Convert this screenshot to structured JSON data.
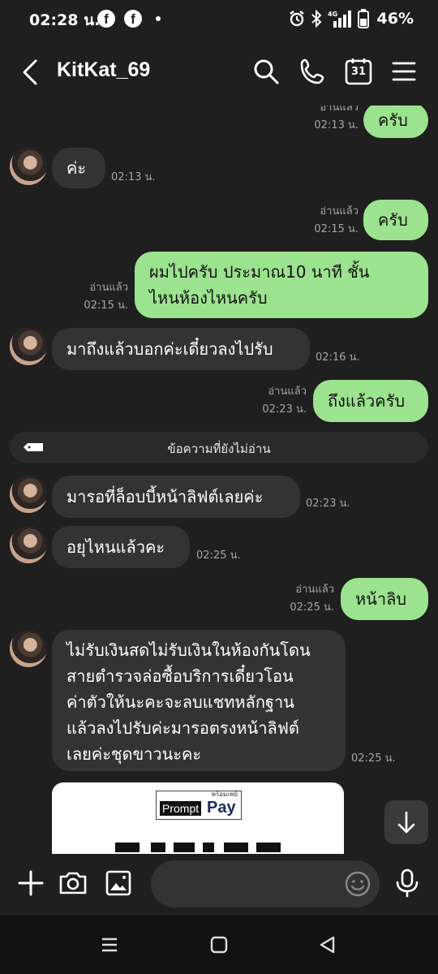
{
  "status_bar": {
    "time": "02:28 น.",
    "battery_percent": "46%",
    "network": "4G",
    "icons": [
      "facebook-icon",
      "facebook-icon",
      "notification-dot",
      "alarm-icon",
      "bluetooth-icon",
      "signal-icon",
      "battery-icon"
    ]
  },
  "header": {
    "title": "KitKat_69",
    "calendar_day": "31",
    "icons": [
      "back-icon",
      "search-icon",
      "phone-icon",
      "calendar-icon",
      "menu-icon"
    ]
  },
  "messages": [
    {
      "side": "out",
      "text": "ครับ",
      "read": "อ่านแล้ว",
      "time": "02:13 น."
    },
    {
      "side": "in",
      "text": "ค่ะ",
      "time": "02:13 น."
    },
    {
      "side": "out",
      "text": "ครับ",
      "read": "อ่านแล้ว",
      "time": "02:15 น."
    },
    {
      "side": "out",
      "lines": [
        "ผมไปครับ ประมาณ10 นาที ชั้น",
        "ไหนห้องไหนครับ"
      ],
      "read": "อ่านแล้ว",
      "time": "02:15 น."
    },
    {
      "side": "in",
      "text": "มาถึงแล้วบอกค่ะเดี๋ยวลงไปรับ",
      "time": "02:16 น."
    },
    {
      "side": "out",
      "text": "ถึงแล้วครับ",
      "read": "อ่านแล้ว",
      "time": "02:23 น."
    },
    {
      "side": "in",
      "text": "มารอที่ล็อบบี้หน้าลิฟต์เลยค่ะ",
      "time": "02:23 น."
    },
    {
      "side": "in",
      "text": "อยุไหนแล้วคะ",
      "time": "02:25 น."
    },
    {
      "side": "out",
      "text": "หน้าลิบ",
      "read": "อ่านแล้ว",
      "time": "02:25 น."
    },
    {
      "side": "in",
      "lines": [
        "ไม่รับเงินสดไม่รับเงินในห้องกันโดน",
        "สายตำรวจล่อซื้อบริการเดี๋ยวโอน",
        "ค่าตัวให้นะคะจะลบแชทหลักฐาน",
        "แล้วลงไปรับค่ะมารอตรงหน้าลิฟต์",
        "เลยค่ะชุดขาวนะคะ"
      ],
      "time": "02:25 น."
    }
  ],
  "unread_divider": "ข้อความที่ยังไม่อ่าน",
  "qr_card": {
    "logo_small": "พร้อมเพย์",
    "logo_prompt": "Prompt",
    "logo_pay": "Pay"
  },
  "input_bar": {
    "icons": [
      "plus-icon",
      "camera-icon",
      "image-icon",
      "emoji-icon",
      "microphone-icon"
    ],
    "placeholder": ""
  },
  "nav_bar": {
    "icons": [
      "recent-apps-icon",
      "home-icon",
      "back-nav-icon"
    ]
  },
  "colors": {
    "background": "#1f1f1f",
    "incoming_bubble": "#333333",
    "outgoing_bubble": "#9ce38f",
    "meta_text": "#a6a6a6"
  }
}
